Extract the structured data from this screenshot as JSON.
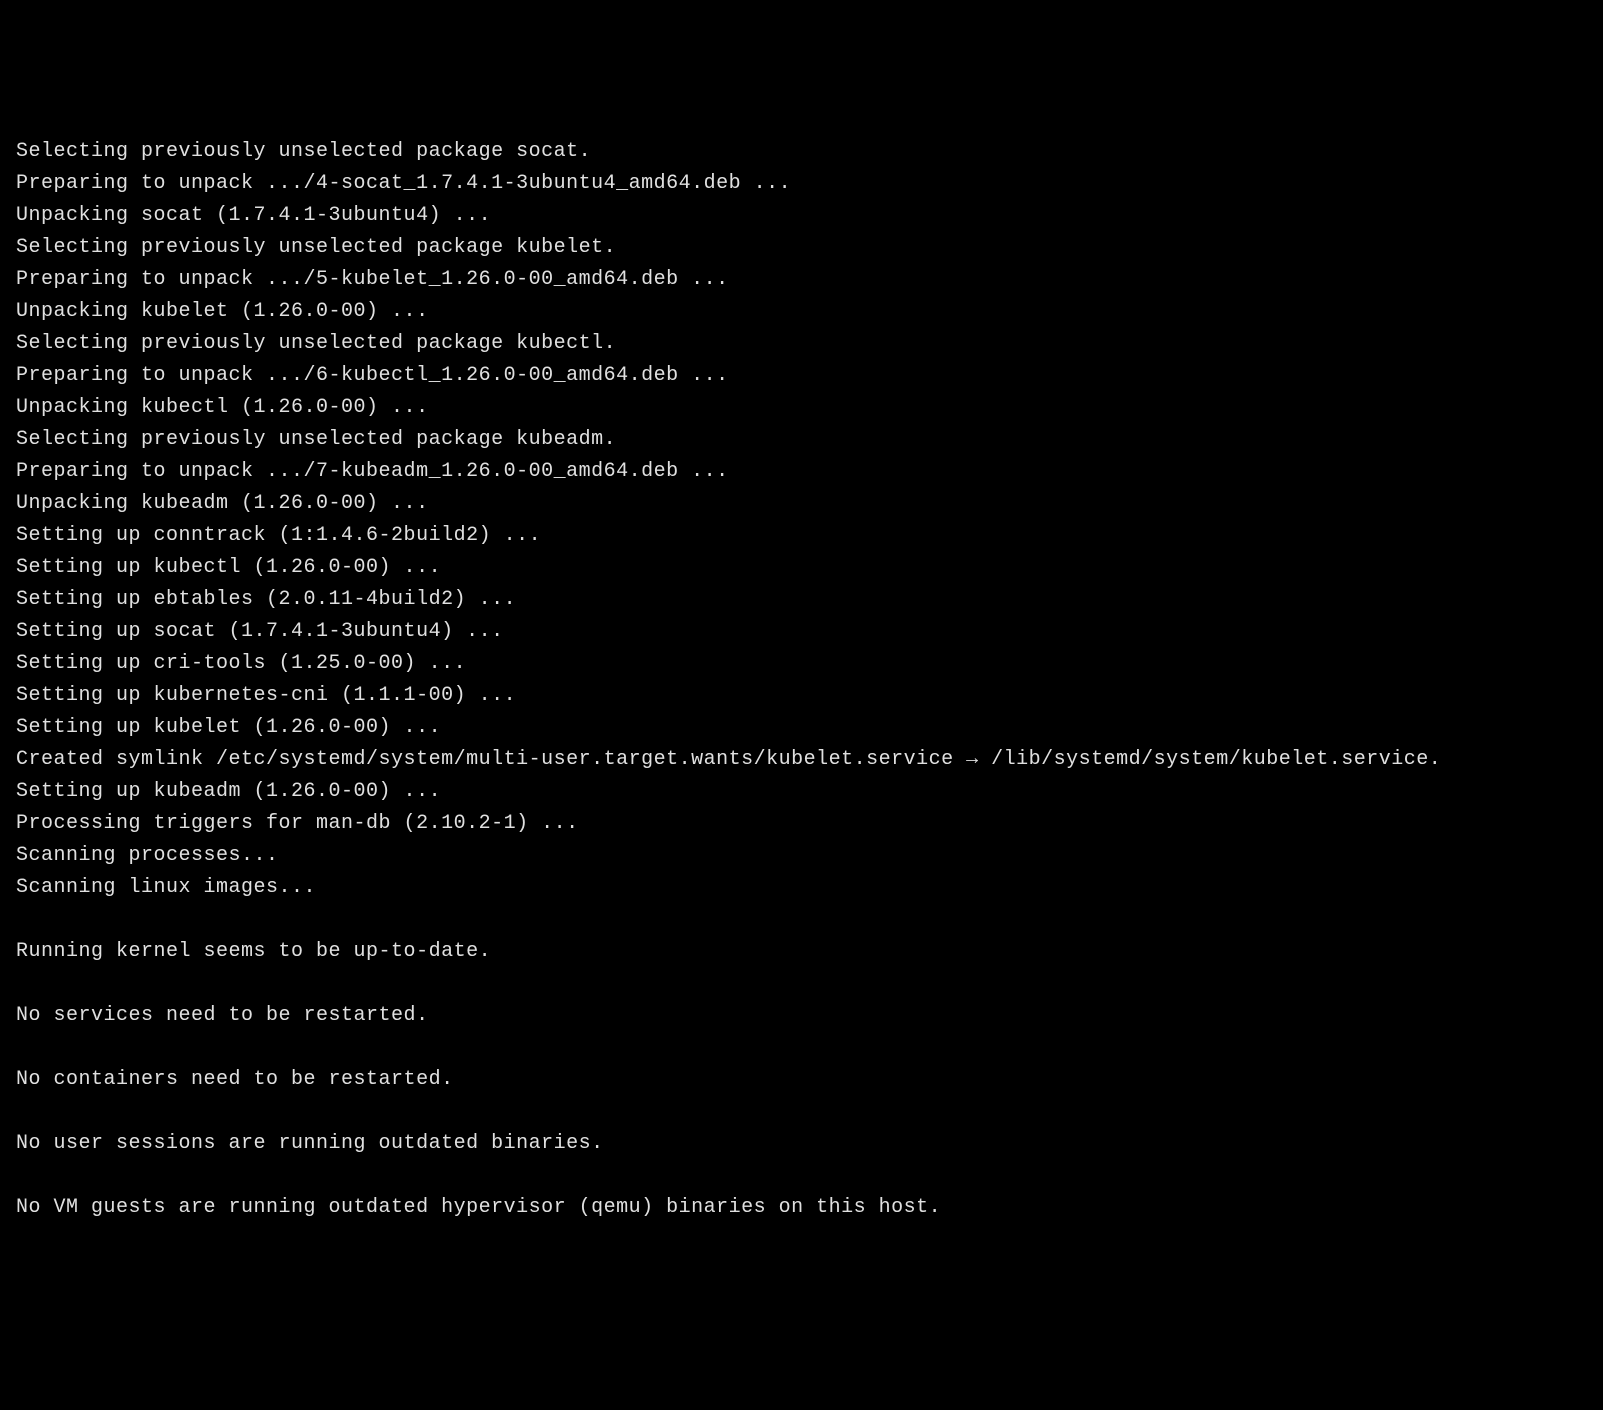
{
  "terminal": {
    "lines": [
      "Selecting previously unselected package socat.",
      "Preparing to unpack .../4-socat_1.7.4.1-3ubuntu4_amd64.deb ...",
      "Unpacking socat (1.7.4.1-3ubuntu4) ...",
      "Selecting previously unselected package kubelet.",
      "Preparing to unpack .../5-kubelet_1.26.0-00_amd64.deb ...",
      "Unpacking kubelet (1.26.0-00) ...",
      "Selecting previously unselected package kubectl.",
      "Preparing to unpack .../6-kubectl_1.26.0-00_amd64.deb ...",
      "Unpacking kubectl (1.26.0-00) ...",
      "Selecting previously unselected package kubeadm.",
      "Preparing to unpack .../7-kubeadm_1.26.0-00_amd64.deb ...",
      "Unpacking kubeadm (1.26.0-00) ...",
      "Setting up conntrack (1:1.4.6-2build2) ...",
      "Setting up kubectl (1.26.0-00) ...",
      "Setting up ebtables (2.0.11-4build2) ...",
      "Setting up socat (1.7.4.1-3ubuntu4) ...",
      "Setting up cri-tools (1.25.0-00) ...",
      "Setting up kubernetes-cni (1.1.1-00) ...",
      "Setting up kubelet (1.26.0-00) ...",
      "Created symlink /etc/systemd/system/multi-user.target.wants/kubelet.service → /lib/systemd/system/kubelet.service.",
      "Setting up kubeadm (1.26.0-00) ...",
      "Processing triggers for man-db (2.10.2-1) ...",
      "Scanning processes...",
      "Scanning linux images...",
      "",
      "Running kernel seems to be up-to-date.",
      "",
      "No services need to be restarted.",
      "",
      "No containers need to be restarted.",
      "",
      "No user sessions are running outdated binaries.",
      "",
      "No VM guests are running outdated hypervisor (qemu) binaries on this host."
    ]
  }
}
